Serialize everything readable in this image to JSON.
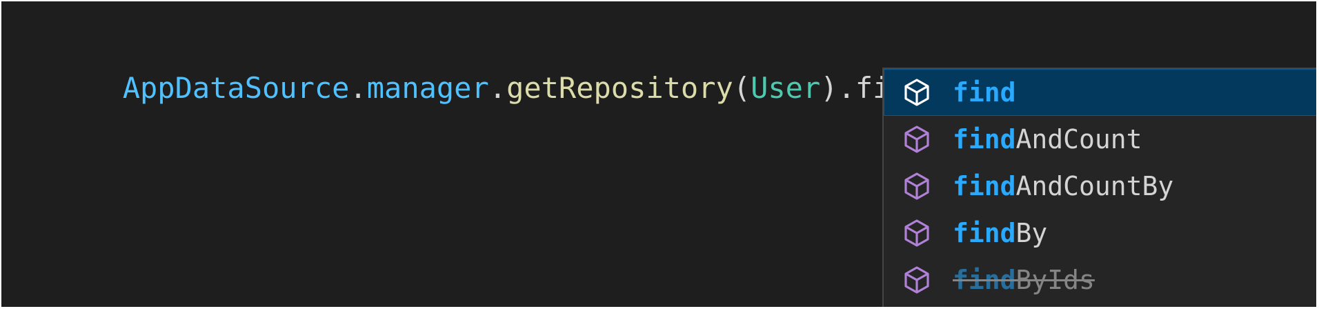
{
  "editor": {
    "code_tokens": [
      {
        "text": "AppDataSource",
        "kind": "var"
      },
      {
        "text": ".",
        "kind": "punct"
      },
      {
        "text": "manager",
        "kind": "prop"
      },
      {
        "text": ".",
        "kind": "punct"
      },
      {
        "text": "getRepository",
        "kind": "fn"
      },
      {
        "text": "(",
        "kind": "punct"
      },
      {
        "text": "User",
        "kind": "class"
      },
      {
        "text": ")",
        "kind": "punct"
      },
      {
        "text": ".",
        "kind": "punct"
      },
      {
        "text": "find",
        "kind": "plain"
      }
    ]
  },
  "suggest": {
    "items": [
      {
        "match": "find",
        "rest": "",
        "icon": "method-cube-icon",
        "selected": true,
        "deprecated": false
      },
      {
        "match": "find",
        "rest": "AndCount",
        "icon": "method-cube-icon",
        "selected": false,
        "deprecated": false
      },
      {
        "match": "find",
        "rest": "AndCountBy",
        "icon": "method-cube-icon",
        "selected": false,
        "deprecated": false
      },
      {
        "match": "find",
        "rest": "By",
        "icon": "method-cube-icon",
        "selected": false,
        "deprecated": false
      },
      {
        "match": "find",
        "rest": "ByIds",
        "icon": "method-cube-icon",
        "selected": false,
        "deprecated": true
      }
    ]
  },
  "colors": {
    "editor_bg": "#1e1e1e",
    "suggest_bg": "#252526",
    "selected_bg": "#04395e",
    "match": "#2aaaff",
    "icon_purple": "#b180d7",
    "icon_selected": "#ffffff"
  }
}
